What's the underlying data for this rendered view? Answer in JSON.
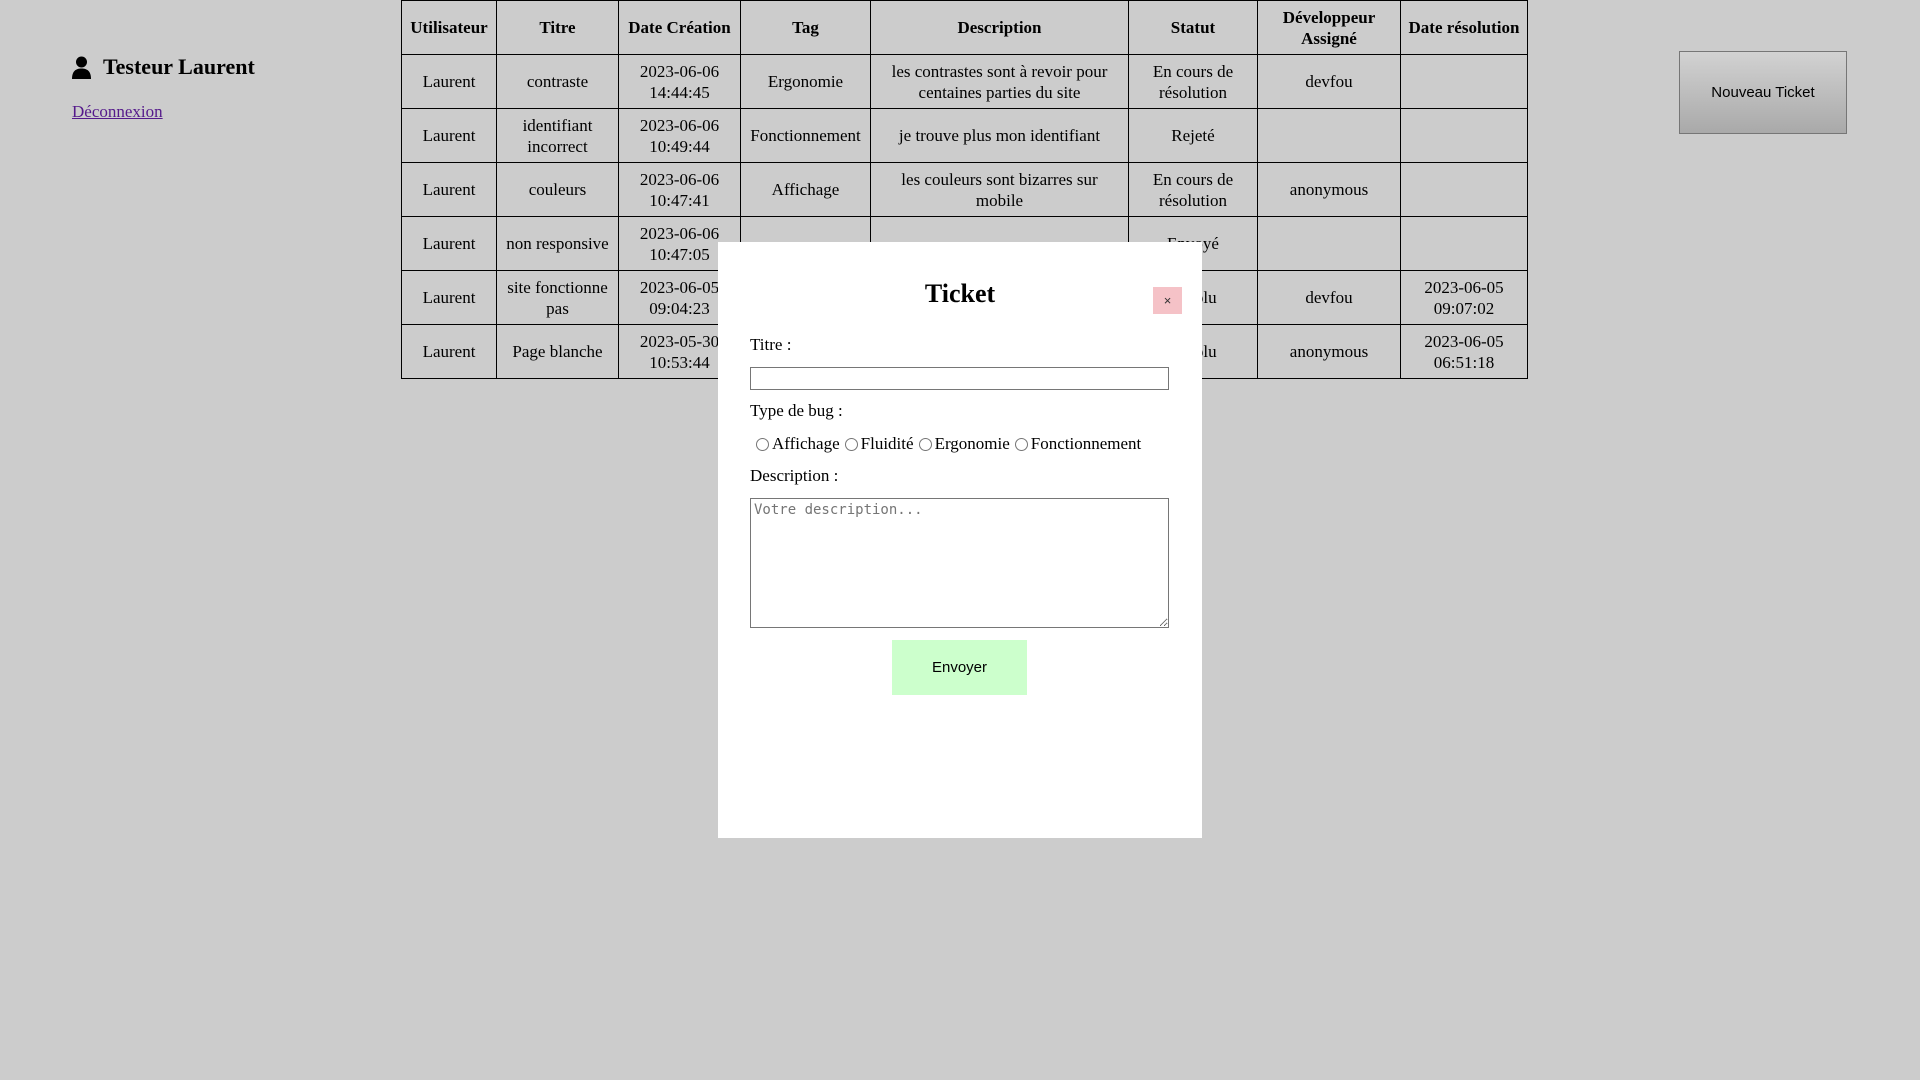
{
  "user": {
    "name": "Testeur Laurent",
    "logout_label": "Déconnexion"
  },
  "table": {
    "headers": [
      "Utilisateur",
      "Titre",
      "Date Création",
      "Tag",
      "Description",
      "Statut",
      "Développeur Assigné",
      "Date résolution"
    ],
    "rows": [
      [
        "Laurent",
        "contraste",
        "2023-06-06 14:44:45",
        "Ergonomie",
        "les contrastes sont à revoir pour centaines parties du site",
        "En cours de résolution",
        "devfou",
        ""
      ],
      [
        "Laurent",
        "identifiant incorrect",
        "2023-06-06 10:49:44",
        "Fonctionnement",
        "je trouve plus mon identifiant",
        "Rejeté",
        "",
        ""
      ],
      [
        "Laurent",
        "couleurs",
        "2023-06-06 10:47:41",
        "Affichage",
        "les couleurs sont bizarres sur mobile",
        "En cours de résolution",
        "anonymous",
        ""
      ],
      [
        "Laurent",
        "non responsive",
        "2023-06-06 10:47:05",
        "",
        "",
        "Envoyé",
        "",
        ""
      ],
      [
        "Laurent",
        "site fonctionne pas",
        "2023-06-05 09:04:23",
        "",
        "",
        "Résolu",
        "devfou",
        "2023-06-05 09:07:02"
      ],
      [
        "Laurent",
        "Page blanche",
        "2023-05-30 10:53:44",
        "",
        "",
        "Résolu",
        "anonymous",
        "2023-06-05 06:51:18"
      ]
    ]
  },
  "new_ticket_label": "Nouveau Ticket",
  "modal": {
    "title": "Ticket",
    "close_label": "×",
    "title_label": "Titre :",
    "title_value": "",
    "bug_type_label": "Type de bug :",
    "bug_types": [
      "Affichage",
      "Fluidité",
      "Ergonomie",
      "Fonctionnement"
    ],
    "description_label": "Description :",
    "description_placeholder": "Votre description...",
    "submit_label": "Envoyer"
  }
}
